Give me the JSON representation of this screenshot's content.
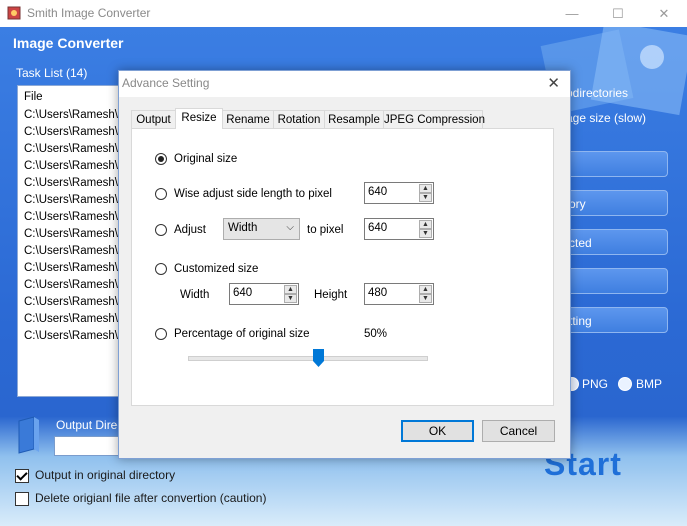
{
  "window": {
    "title": "Smith Image Converter",
    "minimize": "—",
    "maximize": "☐",
    "close": "✕"
  },
  "app": {
    "heading": "Image Converter"
  },
  "task_list": {
    "label": "Task List (14)",
    "header": "File",
    "rows": [
      "C:\\Users\\Ramesh\\D",
      "C:\\Users\\Ramesh\\D",
      "C:\\Users\\Ramesh\\D",
      "C:\\Users\\Ramesh\\D",
      "C:\\Users\\Ramesh\\D",
      "C:\\Users\\Ramesh\\D",
      "C:\\Users\\Ramesh\\D",
      "C:\\Users\\Ramesh\\D",
      "C:\\Users\\Ramesh\\D",
      "C:\\Users\\Ramesh\\D",
      "C:\\Users\\Ramesh\\D",
      "C:\\Users\\Ramesh\\D",
      "C:\\Users\\Ramesh\\D",
      "C:\\Users\\Ramesh\\D"
    ]
  },
  "right_panel": {
    "subdirs_text": "bdirectories",
    "image_size_text": "age size (slow)",
    "btn_ory": "ory",
    "btn_cted": "cted",
    "btn_tting": "tting",
    "format_png": "PNG",
    "format_bmp": "BMP"
  },
  "output": {
    "label": "Output Direc",
    "in_original": "Output in original directory",
    "delete_original": "Delete origianl file after convertion (caution)"
  },
  "start_label": "Start",
  "dialog": {
    "title": "Advance Setting",
    "close": "✕",
    "tabs": [
      "Output",
      "Resize",
      "Rename",
      "Rotation",
      "Resample",
      "JPEG Compression"
    ],
    "active_tab": "Resize",
    "options": {
      "original_size": "Original size",
      "wise_adjust": "Wise adjust side length to pixel",
      "wise_value": "640",
      "adjust": "Adjust",
      "adjust_select": "Width",
      "to_pixel": "to pixel",
      "adjust_value": "640",
      "customized": "Customized size",
      "width_label": "Width",
      "width_value": "640",
      "height_label": "Height",
      "height_value": "480",
      "percentage": "Percentage of original size",
      "percentage_value": "50%"
    },
    "selected_option": "Original size",
    "slider_fraction": 0.5,
    "ok": "OK",
    "cancel": "Cancel"
  },
  "colors": {
    "accent": "#2f72d9",
    "start": "#1f6fd8",
    "dialog_bg": "#f0f0f0"
  }
}
